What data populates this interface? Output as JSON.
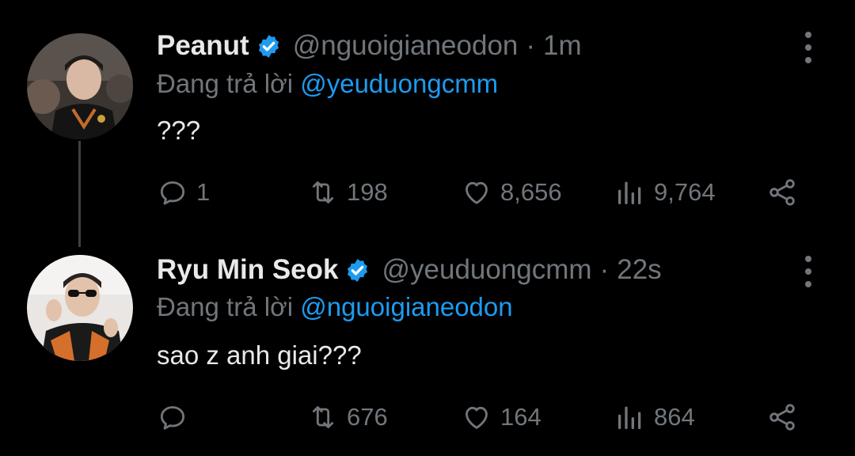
{
  "tweets": [
    {
      "display_name": "Peanut",
      "handle": "@nguoigianeodon",
      "time": "1m",
      "reply_prefix": "Đang trả lời",
      "reply_to": "@yeuduongcmm",
      "text": "???",
      "replies": "1",
      "retweets": "198",
      "likes": "8,656",
      "views": "9,764"
    },
    {
      "display_name": "Ryu Min Seok",
      "handle": "@yeuduongcmm",
      "time": "22s",
      "reply_prefix": "Đang trả lời",
      "reply_to": "@nguoigianeodon",
      "text": "sao z anh giai???",
      "replies": "",
      "retweets": "676",
      "likes": "164",
      "views": "864"
    }
  ],
  "meta_separator": "·",
  "colors": {
    "accent": "#1d9bf0",
    "muted": "#71767b",
    "text": "#e7e9ea",
    "background": "#000000"
  },
  "icons": [
    "reply-icon",
    "retweet-icon",
    "like-icon",
    "views-icon",
    "share-icon",
    "more-icon",
    "verified-icon"
  ]
}
